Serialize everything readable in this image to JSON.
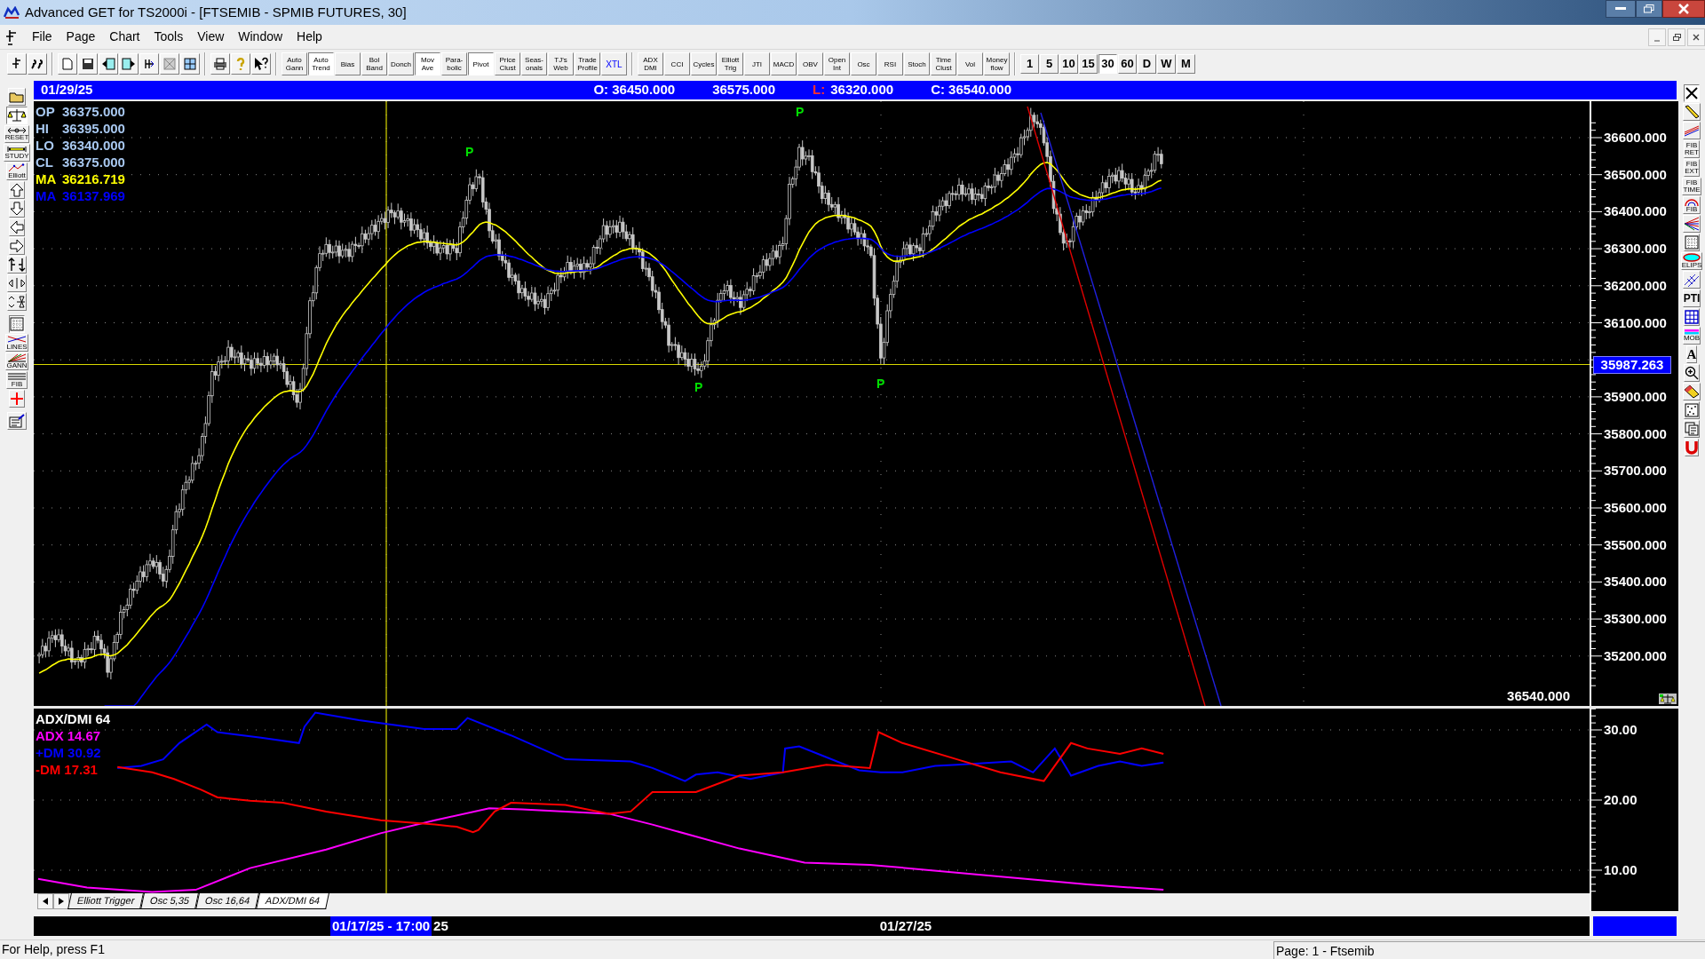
{
  "window": {
    "title": "Advanced GET for TS2000i - [FTSEMIB - SPMIB FUTURES, 30]"
  },
  "menu": [
    "File",
    "Page",
    "Chart",
    "Tools",
    "View",
    "Window",
    "Help"
  ],
  "study_buttons": [
    {
      "label": "Auto\nGann",
      "pressed": false
    },
    {
      "label": "Auto\nTrend",
      "pressed": true
    },
    {
      "label": "Bias",
      "pressed": false
    },
    {
      "label": "Bol\nBand",
      "pressed": false
    },
    {
      "label": "Donch",
      "pressed": false
    },
    {
      "label": "Mov\nAve",
      "pressed": true
    },
    {
      "label": "Para-\nbolic",
      "pressed": false
    },
    {
      "label": "Pivot",
      "pressed": true
    },
    {
      "label": "Price\nClust",
      "pressed": false
    },
    {
      "label": "Seas-\nonals",
      "pressed": false
    },
    {
      "label": "TJ's\nWeb",
      "pressed": false
    },
    {
      "label": "Trade\nProfile",
      "pressed": false
    },
    {
      "label": "XTL",
      "pressed": false
    }
  ],
  "indicator_buttons": [
    {
      "label": "ADX\nDMI",
      "pressed": false
    },
    {
      "label": "CCI",
      "pressed": false
    },
    {
      "label": "Cycles",
      "pressed": false
    },
    {
      "label": "Elliott\nTrig",
      "pressed": false
    },
    {
      "label": "JTI",
      "pressed": false
    },
    {
      "label": "MACD",
      "pressed": false
    },
    {
      "label": "OBV",
      "pressed": false
    },
    {
      "label": "Open\nInt",
      "pressed": false
    },
    {
      "label": "Osc",
      "pressed": false
    },
    {
      "label": "RSI",
      "pressed": false
    },
    {
      "label": "Stoch",
      "pressed": false
    },
    {
      "label": "Time\nClust",
      "pressed": false
    },
    {
      "label": "Vol",
      "pressed": false
    },
    {
      "label": "Money\nflow",
      "pressed": false
    }
  ],
  "intervals": [
    {
      "label": "1",
      "selected": false
    },
    {
      "label": "5",
      "selected": false
    },
    {
      "label": "10",
      "selected": false
    },
    {
      "label": "15",
      "selected": false
    },
    {
      "label": "30",
      "selected": true
    },
    {
      "label": "60",
      "selected": false
    },
    {
      "label": "D",
      "selected": false
    },
    {
      "label": "W",
      "selected": false
    },
    {
      "label": "M",
      "selected": false
    }
  ],
  "left_toolbar": [
    {
      "kind": "folder",
      "pressed": false
    },
    {
      "kind": "scales",
      "pressed": true
    },
    {
      "kind": "reset",
      "label": "RESET",
      "pressed": false
    },
    {
      "kind": "study",
      "label": "STUDY",
      "pressed": false
    },
    {
      "kind": "elliott",
      "label": "Elliott",
      "pressed": false
    },
    {
      "kind": "up",
      "pressed": false
    },
    {
      "kind": "down",
      "pressed": false
    },
    {
      "kind": "left",
      "pressed": false
    },
    {
      "kind": "right",
      "pressed": false
    },
    {
      "kind": "vstretch",
      "pressed": false
    },
    {
      "kind": "hstretch",
      "pressed": false
    },
    {
      "kind": "vsqueeze",
      "pressed": false
    },
    {
      "kind": "grid",
      "pressed": true
    },
    {
      "kind": "lines",
      "label": "LINES",
      "pressed": false
    },
    {
      "kind": "gann",
      "label": "GANN",
      "pressed": false
    },
    {
      "kind": "fib",
      "label": "FIB",
      "pressed": false
    },
    {
      "kind": "cross",
      "pressed": false
    },
    {
      "kind": "properties",
      "pressed": false
    }
  ],
  "right_toolbar": [
    {
      "kind": "close",
      "pressed": true
    },
    {
      "kind": "pencil",
      "pressed": false
    },
    {
      "kind": "parallel",
      "pressed": false
    },
    {
      "kind": "text",
      "label": "FIB\nRET",
      "pressed": false
    },
    {
      "kind": "text",
      "label": "FIB\nEXT",
      "pressed": false
    },
    {
      "kind": "text",
      "label": "FIB\nTIME",
      "pressed": false
    },
    {
      "kind": "arc",
      "label": "FIB",
      "pressed": false
    },
    {
      "kind": "fan",
      "pressed": false
    },
    {
      "kind": "grid",
      "pressed": false
    },
    {
      "kind": "ellipse",
      "label": "ELIPS",
      "pressed": false
    },
    {
      "kind": "channel",
      "pressed": false
    },
    {
      "kind": "bold",
      "label": "PTI",
      "pressed": false
    },
    {
      "kind": "bluegrid",
      "pressed": false
    },
    {
      "kind": "mob",
      "label": "MOB",
      "pressed": false
    },
    {
      "kind": "serif",
      "label": "A",
      "pressed": false
    },
    {
      "kind": "zoom",
      "pressed": false
    },
    {
      "kind": "eraser",
      "pressed": false
    },
    {
      "kind": "pattern",
      "pressed": false
    },
    {
      "kind": "copy",
      "pressed": false
    },
    {
      "kind": "magnet",
      "pressed": false
    }
  ],
  "quote_bar": {
    "date": "01/29/25",
    "fields": [
      {
        "text": "O: 36450.000"
      },
      {
        "text": "36575.000"
      },
      {
        "label": "L:",
        "text": "36320.000"
      },
      {
        "text": "C: 36540.000"
      }
    ]
  },
  "price_panel": {
    "legend": [
      {
        "label": "OP",
        "value": "36375.000",
        "color": "#a8c8f0"
      },
      {
        "label": "HI",
        "value": "36395.000",
        "color": "#a8c8f0"
      },
      {
        "label": "LO",
        "value": "36340.000",
        "color": "#a8c8f0"
      },
      {
        "label": "CL",
        "value": "36375.000",
        "color": "#a8c8f0"
      },
      {
        "label": "MA",
        "value": "36216.719",
        "color": "#ffff00"
      },
      {
        "label": "MA",
        "value": "36137.969",
        "color": "#0000ff"
      }
    ],
    "pivots": [
      "P",
      "P",
      "P",
      "P"
    ],
    "axis_labels": [
      "36600.000",
      "36500.000",
      "36400.000",
      "36300.000",
      "36200.000",
      "36100.000",
      "35900.000",
      "35800.000",
      "35700.000",
      "35600.000",
      "35500.000",
      "35400.000",
      "35300.000",
      "35200.000"
    ],
    "marker": "35987.263",
    "last_price": "36540.000"
  },
  "indicator_panel": {
    "title": "ADX/DMI 64",
    "legend": [
      {
        "label": "ADX",
        "value": "14.67",
        "color": "#ff00ff"
      },
      {
        "label": "+DM",
        "value": "30.92",
        "color": "#0000ff"
      },
      {
        "label": "-DM",
        "value": "17.31",
        "color": "#ff0000"
      }
    ],
    "axis_labels": [
      "30.00",
      "20.00",
      "10.00"
    ]
  },
  "tabs": [
    {
      "label": "Elliott Trigger",
      "selected": false
    },
    {
      "label": "Osc 5,35",
      "selected": false
    },
    {
      "label": "Osc 16,64",
      "selected": false
    },
    {
      "label": "ADX/DMI 64",
      "selected": true
    }
  ],
  "date_bar": {
    "cursor": "01/17/25 - 17:00",
    "cursor_suffix": "25",
    "dates": [
      "01/27/25"
    ]
  },
  "status_bar": {
    "help": "For Help, press F1",
    "page": "Page: 1 - Ftsemib"
  }
}
